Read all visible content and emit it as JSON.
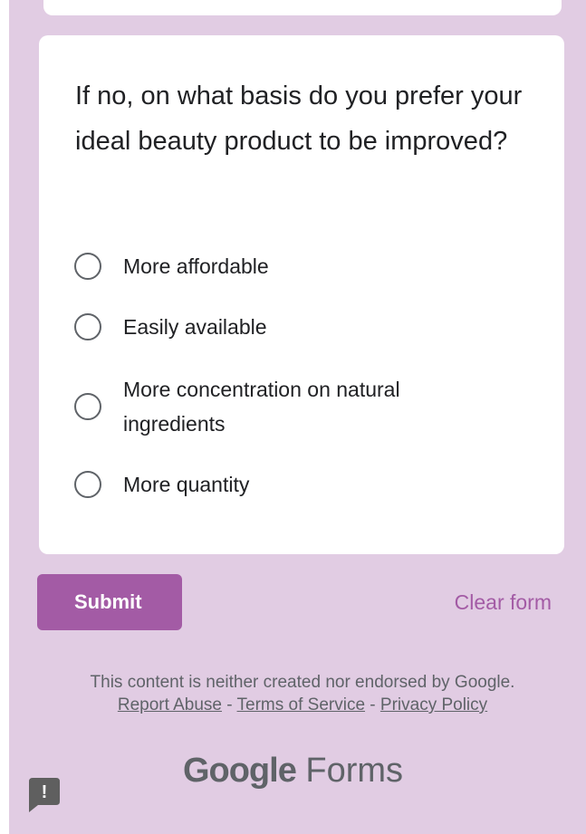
{
  "question": {
    "title": "If no, on what basis do you prefer your ideal beauty product to be improved?",
    "options": [
      {
        "label": "More affordable"
      },
      {
        "label": "Easily available"
      },
      {
        "label": "More concentration on natural ingredients"
      },
      {
        "label": "More quantity"
      }
    ]
  },
  "actions": {
    "submit_label": "Submit",
    "clear_label": "Clear form"
  },
  "footer": {
    "disclaimer": "This content is neither created nor endorsed by Google.",
    "report_abuse": "Report Abuse",
    "separator": " - ",
    "terms": "Terms of Service",
    "privacy": "Privacy Policy",
    "logo_google": "Google",
    "logo_forms": "Forms"
  },
  "feedback": {
    "icon": "feedback-icon",
    "glyph": "!"
  },
  "colors": {
    "background": "#e1cce3",
    "accent": "#a35ba5",
    "card": "#ffffff",
    "text": "#202124"
  }
}
